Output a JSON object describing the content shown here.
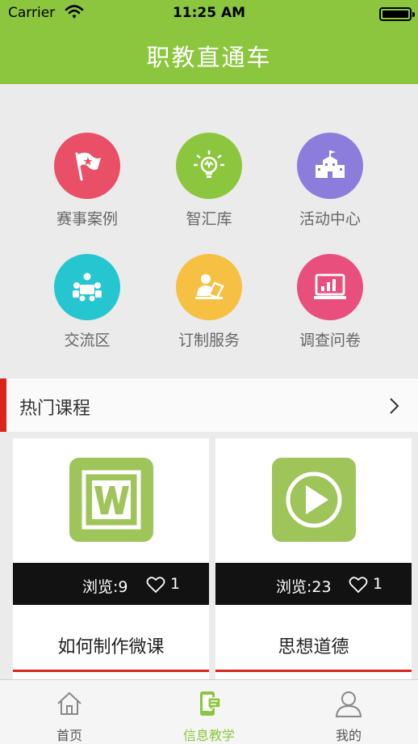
{
  "status_bar": {
    "carrier": "Carrier",
    "time": "11:25 AM"
  },
  "header": {
    "title": "职教直通车"
  },
  "menu": [
    {
      "label": "赛事案例",
      "icon": "flag-icon",
      "color": "#e94f66"
    },
    {
      "label": "智汇库",
      "icon": "lightbulb-icon",
      "color": "#8cc63e"
    },
    {
      "label": "活动中心",
      "icon": "building-icon",
      "color": "#8c7ddc"
    },
    {
      "label": "交流区",
      "icon": "meeting-icon",
      "color": "#26c6d0"
    },
    {
      "label": "订制服务",
      "icon": "user-desk-icon",
      "color": "#f6c043"
    },
    {
      "label": "调查问卷",
      "icon": "monitor-chart-icon",
      "color": "#e94f7d"
    }
  ],
  "section": {
    "title": "热门课程"
  },
  "courses": [
    {
      "title": "如何制作微课",
      "views": "浏览:9",
      "likes": "1",
      "icon": "word-document-icon"
    },
    {
      "title": "思想道德",
      "views": "浏览:23",
      "likes": "1",
      "icon": "play-icon"
    }
  ],
  "tabbar": [
    {
      "label": "首页",
      "icon": "home-icon"
    },
    {
      "label": "信息教学",
      "icon": "phone-chat-icon"
    },
    {
      "label": "我的",
      "icon": "user-icon"
    }
  ],
  "colors": {
    "accent": "#8cc63e",
    "red": "#d9251d",
    "dark": "#121212"
  }
}
